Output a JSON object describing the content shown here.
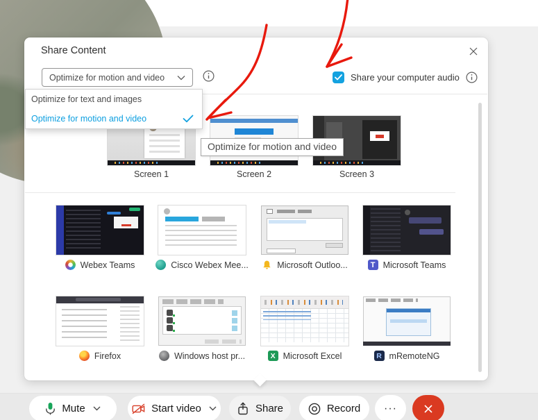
{
  "dialog": {
    "title": "Share Content",
    "optimize_select": {
      "value": "Optimize for motion and video"
    },
    "audio_checkbox": {
      "label": "Share your computer audio",
      "checked": true
    },
    "menu": {
      "items": [
        {
          "label": "Optimize for text and images",
          "selected": false
        },
        {
          "label": "Optimize for motion and video",
          "selected": true
        }
      ]
    },
    "tooltip": "Optimize for motion and video",
    "screens": [
      {
        "label": "Screen 1"
      },
      {
        "label": "Screen 2"
      },
      {
        "label": "Screen 3"
      }
    ],
    "apps": [
      {
        "label": "Webex Teams",
        "icon": "webex-teams-icon"
      },
      {
        "label": "Cisco Webex Mee...",
        "icon": "cisco-webex-icon"
      },
      {
        "label": "Microsoft Outloo...",
        "icon": "outlook-reminder-bell-icon"
      },
      {
        "label": "Microsoft Teams",
        "icon": "microsoft-teams-icon"
      },
      {
        "label": "Firefox",
        "icon": "firefox-icon"
      },
      {
        "label": "Windows host pr...",
        "icon": "windows-host-icon"
      },
      {
        "label": "Microsoft Excel",
        "icon": "excel-icon"
      },
      {
        "label": "mRemoteNG",
        "icon": "mremoteng-icon"
      }
    ],
    "app_icon_letters": {
      "teams": "T",
      "excel": "X",
      "mremoteng": "R"
    }
  },
  "toolbar": {
    "mute_label": "Mute",
    "start_video_label": "Start video",
    "share_label": "Share",
    "record_label": "Record",
    "more_label": "···"
  },
  "colors": {
    "accent_blue": "#14a2e0",
    "selected_menu_text": "#0d9fe0",
    "annotation_red": "#e8190d",
    "end_call_red": "#da3a21",
    "mic_green": "#18a55a",
    "video_off_red": "#d8402a"
  }
}
